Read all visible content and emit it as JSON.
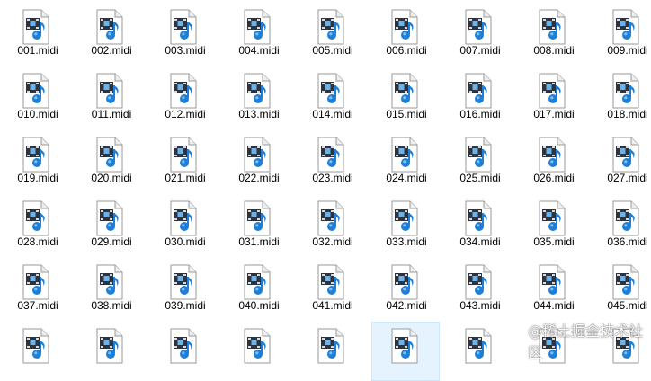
{
  "explorer": {
    "view": "large-icons",
    "icon": "midi-audio-file-icon",
    "files": [
      "001.midi",
      "002.midi",
      "003.midi",
      "004.midi",
      "005.midi",
      "006.midi",
      "007.midi",
      "008.midi",
      "009.midi",
      "010.midi",
      "011.midi",
      "012.midi",
      "013.midi",
      "014.midi",
      "015.midi",
      "016.midi",
      "017.midi",
      "018.midi",
      "019.midi",
      "020.midi",
      "021.midi",
      "022.midi",
      "023.midi",
      "024.midi",
      "025.midi",
      "026.midi",
      "027.midi",
      "028.midi",
      "029.midi",
      "030.midi",
      "031.midi",
      "032.midi",
      "033.midi",
      "034.midi",
      "035.midi",
      "036.midi",
      "037.midi",
      "038.midi",
      "039.midi",
      "040.midi",
      "041.midi",
      "042.midi",
      "043.midi",
      "044.midi",
      "045.midi",
      "",
      "",
      "",
      "",
      "",
      "",
      "",
      "",
      ""
    ],
    "selected_index": 50
  },
  "watermark": {
    "text": "@稀土掘金技术社区"
  },
  "colors": {
    "selection": "#e5f3ff",
    "selection_border": "#cce8ff",
    "note_blue": "#1e7fd8"
  }
}
